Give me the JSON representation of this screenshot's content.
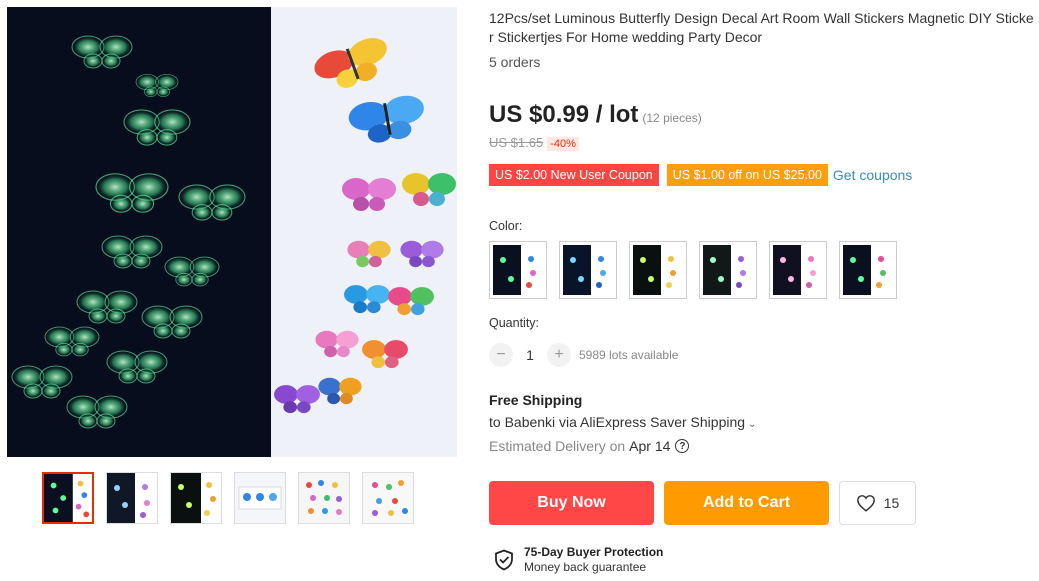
{
  "product": {
    "title": "12Pcs/set Luminous Butterfly Design Decal Art Room Wall Stickers Magnetic DIY Sticker Stickertjes For Home wedding Party Decor",
    "orders": "5 orders",
    "price": "US $0.99 / lot",
    "pieces": "(12 pieces)",
    "old_price": "US $1.65",
    "discount": "-40%"
  },
  "coupons": {
    "new_user": "US $2.00 New User Coupon",
    "off": "US $1.00 off on US $25.00",
    "get_link": "Get coupons"
  },
  "color": {
    "label": "Color:",
    "options": [
      "variant-1",
      "variant-2",
      "variant-3",
      "variant-4",
      "variant-5",
      "variant-6"
    ]
  },
  "quantity": {
    "label": "Quantity:",
    "minus": "−",
    "value": "1",
    "plus": "+",
    "available": "5989 lots available"
  },
  "shipping": {
    "title": "Free Shipping",
    "to": "to Babenki via AliExpress Saver Shipping",
    "chevron": "⌄",
    "delivery_prefix": "Estimated Delivery on",
    "delivery_date": "Apr 14",
    "help": "?"
  },
  "actions": {
    "buy_now": "Buy Now",
    "add_to_cart": "Add to Cart",
    "wishlist_count": "15"
  },
  "protection": {
    "title": "75-Day Buyer Protection",
    "subtitle": "Money back guarantee"
  },
  "gallery": {
    "thumbnails": 6,
    "active_index": 0
  },
  "colors": {
    "buy_now": "#ff4747",
    "add_to_cart": "#ff9a00",
    "coupon_red": "#ff4444",
    "coupon_orange": "#ff9e0b",
    "link": "#3a8dc1",
    "glow": "#5dff9a"
  }
}
